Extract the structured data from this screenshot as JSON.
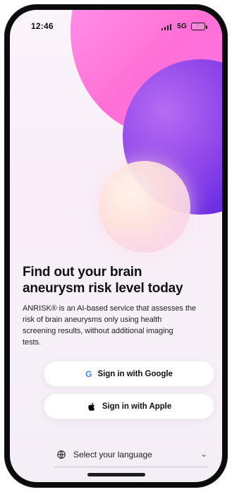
{
  "status_bar": {
    "time": "12:46",
    "network": "5G",
    "icons": [
      "signal-icon",
      "battery-icon",
      "charging-bolt-icon"
    ]
  },
  "hero": {
    "headline": "Find out your brain\naneurysm risk level today",
    "description": "ANRISK® is an AI-based service that assesses the\nrisk of brain aneurysms only using health\nscreening results, without additional imaging\ntests."
  },
  "auth": {
    "google": {
      "label": "Sign in with Google",
      "icon": "google-icon",
      "icon_color": "#4285F4"
    },
    "apple": {
      "label": "Sign in with Apple",
      "icon": "apple-icon",
      "icon_color": "#000000"
    }
  },
  "language": {
    "label": "Select your language",
    "icon": "globe-icon",
    "chevron_icon": "chevron-down-icon"
  },
  "colors": {
    "pink_blob": "#ff73d0",
    "purple_blob": "#6d2fe4",
    "background": "#f7eef8",
    "button_bg": "#ffffff"
  }
}
